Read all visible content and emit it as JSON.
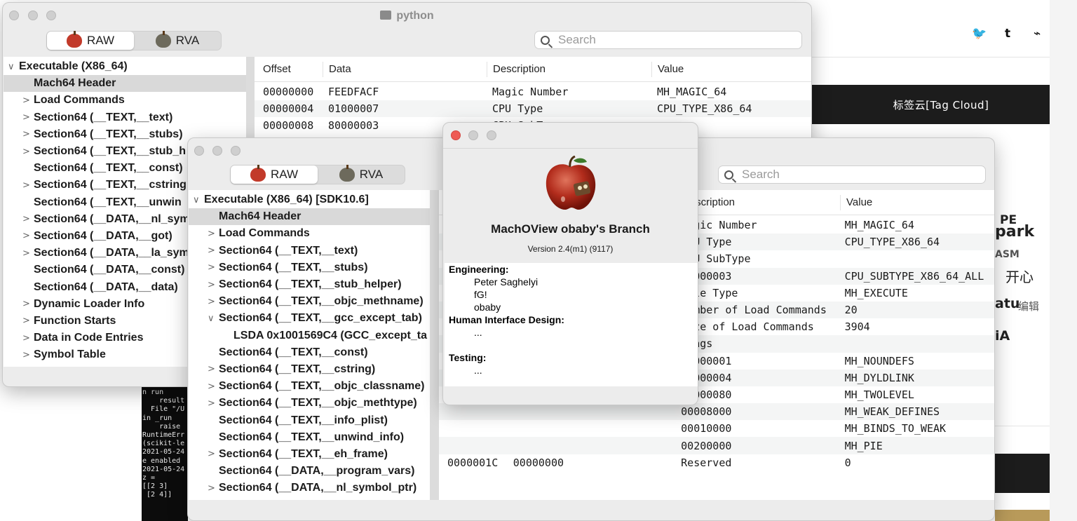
{
  "web": {
    "social_icons": [
      "twitter-icon",
      "tumblr-icon",
      "rss-icon"
    ],
    "twitter_glyph": "🐦",
    "tumblr_glyph": "t",
    "rss_glyph": "⌁",
    "tag_cloud_title": "标签云[Tag Cloud]",
    "tag_words": [
      "PE",
      "park",
      "ASM",
      "开心",
      "atu",
      "编辑",
      "iA"
    ]
  },
  "terminal": {
    "lines": [
      "n run",
      "    result",
      "  File \"/U",
      "in _run",
      "    raise",
      "RuntimeErr",
      "(scikit-le",
      "2021-05-24",
      "e enabled",
      "2021-05-24",
      "z =",
      "[[2 3]",
      " [2 4]]"
    ]
  },
  "win1": {
    "title": "python",
    "raw_label": "RAW",
    "rva_label": "RVA",
    "search_placeholder": "Search",
    "tree": [
      {
        "label": "Executable  (X86_64)",
        "indent": 0,
        "chevron": "∨"
      },
      {
        "label": "Mach64 Header",
        "indent": 1,
        "chevron": "",
        "selected": true
      },
      {
        "label": "Load Commands",
        "indent": 1,
        "chevron": ">"
      },
      {
        "label": "Section64 (__TEXT,__text)",
        "indent": 1,
        "chevron": ">"
      },
      {
        "label": "Section64 (__TEXT,__stubs)",
        "indent": 1,
        "chevron": ">"
      },
      {
        "label": "Section64 (__TEXT,__stub_h",
        "indent": 1,
        "chevron": ">"
      },
      {
        "label": "Section64 (__TEXT,__const)",
        "indent": 1,
        "chevron": ""
      },
      {
        "label": "Section64 (__TEXT,__cstring",
        "indent": 1,
        "chevron": ">"
      },
      {
        "label": "Section64 (__TEXT,__unwin",
        "indent": 1,
        "chevron": ""
      },
      {
        "label": "Section64 (__DATA,__nl_sym",
        "indent": 1,
        "chevron": ">"
      },
      {
        "label": "Section64 (__DATA,__got)",
        "indent": 1,
        "chevron": ">"
      },
      {
        "label": "Section64 (__DATA,__la_sym",
        "indent": 1,
        "chevron": ">"
      },
      {
        "label": "Section64 (__DATA,__const)",
        "indent": 1,
        "chevron": ""
      },
      {
        "label": "Section64 (__DATA,__data)",
        "indent": 1,
        "chevron": ""
      },
      {
        "label": "Dynamic Loader Info",
        "indent": 1,
        "chevron": ">"
      },
      {
        "label": "Function Starts",
        "indent": 1,
        "chevron": ">"
      },
      {
        "label": "Data in Code Entries",
        "indent": 1,
        "chevron": ">"
      },
      {
        "label": "Symbol Table",
        "indent": 1,
        "chevron": ">"
      }
    ],
    "columns": [
      "Offset",
      "Data",
      "Description",
      "Value"
    ],
    "rows": [
      [
        "00000000",
        "FEEDFACF",
        "Magic Number",
        "MH_MAGIC_64"
      ],
      [
        "00000004",
        "01000007",
        "CPU Type",
        "CPU_TYPE_X86_64"
      ],
      [
        "00000008",
        "80000003",
        "CPU SubT",
        ""
      ]
    ]
  },
  "win2": {
    "raw_label": "RAW",
    "rva_label": "RVA",
    "search_placeholder": "Search",
    "tree": [
      {
        "label": "Executable  (X86_64) [SDK10.6]",
        "indent": 0,
        "chevron": "∨"
      },
      {
        "label": "Mach64 Header",
        "indent": 1,
        "chevron": "",
        "selected": true
      },
      {
        "label": "Load Commands",
        "indent": 1,
        "chevron": ">"
      },
      {
        "label": "Section64 (__TEXT,__text)",
        "indent": 1,
        "chevron": ">"
      },
      {
        "label": "Section64 (__TEXT,__stubs)",
        "indent": 1,
        "chevron": ">"
      },
      {
        "label": "Section64 (__TEXT,__stub_helper)",
        "indent": 1,
        "chevron": ">"
      },
      {
        "label": "Section64 (__TEXT,__objc_methname)",
        "indent": 1,
        "chevron": ">"
      },
      {
        "label": "Section64 (__TEXT,__gcc_except_tab)",
        "indent": 1,
        "chevron": "∨"
      },
      {
        "label": "LSDA 0x1001569C4 (GCC_except_ta",
        "indent": 2,
        "chevron": ""
      },
      {
        "label": "Section64 (__TEXT,__const)",
        "indent": 1,
        "chevron": ""
      },
      {
        "label": "Section64 (__TEXT,__cstring)",
        "indent": 1,
        "chevron": ">"
      },
      {
        "label": "Section64 (__TEXT,__objc_classname)",
        "indent": 1,
        "chevron": ">"
      },
      {
        "label": "Section64 (__TEXT,__objc_methtype)",
        "indent": 1,
        "chevron": ">"
      },
      {
        "label": "Section64 (__TEXT,__info_plist)",
        "indent": 1,
        "chevron": ""
      },
      {
        "label": "Section64 (__TEXT,__unwind_info)",
        "indent": 1,
        "chevron": ""
      },
      {
        "label": "Section64 (__TEXT,__eh_frame)",
        "indent": 1,
        "chevron": ">"
      },
      {
        "label": "Section64 (__DATA,__program_vars)",
        "indent": 1,
        "chevron": ""
      },
      {
        "label": "Section64 (__DATA,__nl_symbol_ptr)",
        "indent": 1,
        "chevron": ">"
      }
    ],
    "columns": [
      "",
      "",
      "Description",
      "Value"
    ],
    "rows": [
      [
        "",
        "",
        "Magic Number",
        "MH_MAGIC_64"
      ],
      [
        "",
        "",
        "CPU Type",
        "CPU_TYPE_X86_64"
      ],
      [
        "",
        "",
        "CPU SubType",
        ""
      ],
      [
        "",
        "",
        "80000003",
        "CPU_SUBTYPE_X86_64_ALL"
      ],
      [
        "",
        "",
        "File Type",
        "MH_EXECUTE"
      ],
      [
        "",
        "",
        "Number of Load Commands",
        "20"
      ],
      [
        "",
        "",
        "Size of Load Commands",
        "3904"
      ],
      [
        "",
        "",
        "Flags",
        ""
      ],
      [
        "",
        "",
        "00000001",
        "MH_NOUNDEFS"
      ],
      [
        "",
        "",
        "00000004",
        "MH_DYLDLINK"
      ],
      [
        "",
        "",
        "00000080",
        "MH_TWOLEVEL"
      ],
      [
        "",
        "",
        "00008000",
        "MH_WEAK_DEFINES"
      ],
      [
        "",
        "",
        "00010000",
        "MH_BINDS_TO_WEAK"
      ],
      [
        "",
        "",
        "00200000",
        "MH_PIE"
      ],
      [
        "0000001C",
        "00000000",
        "Reserved",
        "0"
      ]
    ]
  },
  "about": {
    "app_name": "MachOView obaby's Branch",
    "version": "Version 2.4(m1) (9117)",
    "credits": [
      {
        "type": "head",
        "text": "Engineering:"
      },
      {
        "type": "item",
        "text": "Peter Saghelyi"
      },
      {
        "type": "item",
        "text": "fG!"
      },
      {
        "type": "item",
        "text": "obaby"
      },
      {
        "type": "head",
        "text": "Human Interface Design:"
      },
      {
        "type": "item",
        "text": "..."
      },
      {
        "type": "gap",
        "text": ""
      },
      {
        "type": "head",
        "text": "Testing:"
      },
      {
        "type": "item",
        "text": "..."
      }
    ]
  }
}
